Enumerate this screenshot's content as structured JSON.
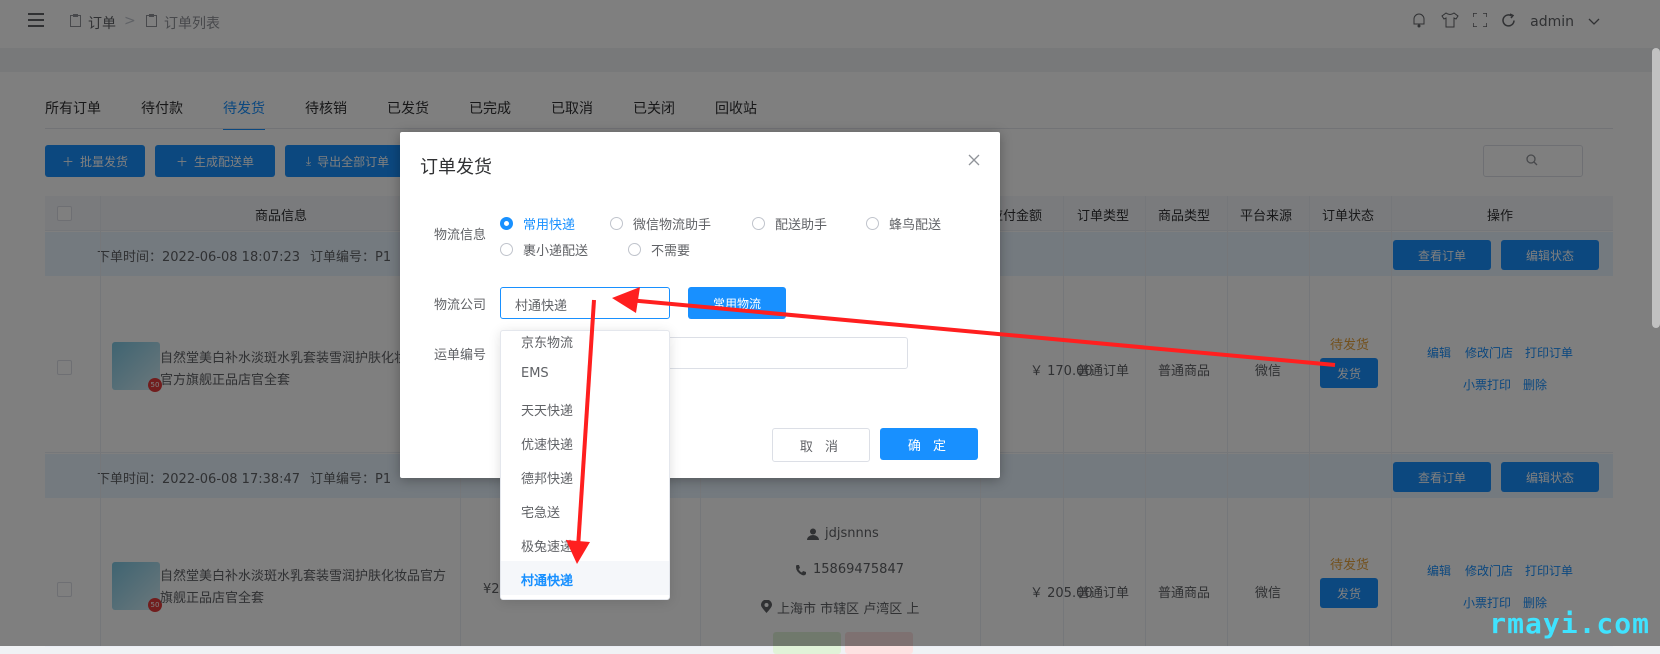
{
  "header": {
    "breadcrumb": [
      "订单",
      "订单列表"
    ],
    "separator": ">",
    "user": "admin"
  },
  "tabs": [
    "所有订单",
    "待付款",
    "待发货",
    "待核销",
    "已发货",
    "已完成",
    "已取消",
    "已关闭",
    "回收站"
  ],
  "active_tab": "待发货",
  "toolbar": {
    "batch_ship": "批量发货",
    "gen_delivery": "生成配送单",
    "export_all": "导出全部订单"
  },
  "table": {
    "columns": [
      "商品信息",
      "应付金额",
      "订单类型",
      "商品类型",
      "平台来源",
      "订单状态",
      "操作"
    ]
  },
  "orders": [
    {
      "time_label": "下单时间：2022-06-08 18:07:23",
      "no_label": "订单编号：P1",
      "product": "自然堂美白补水淡斑水乳套装雪润护肤化妆品官方旗舰正品店官全套",
      "amount": "￥ 170.00",
      "order_type": "普通订单",
      "goods_type": "普通商品",
      "source": "微信",
      "status": "待发货",
      "ship_btn": "发货",
      "view_btn": "查看订单",
      "edit_status_btn": "编辑状态",
      "links": [
        "编辑",
        "修改门店",
        "打印订单",
        "小票打印",
        "删除"
      ]
    },
    {
      "time_label": "下单时间：2022-06-08 17:38:47",
      "no_label": "订单编号：P1",
      "product": "自然堂美白补水淡斑水乳套装雪润护肤化妆品官方旗舰正品店官全套",
      "price_prefix": "¥2",
      "buyer": "jdjsnnns",
      "phone": "15869475847",
      "address": "上海市 市辖区 卢湾区 上",
      "amount": "￥ 205.00",
      "order_type": "普通订单",
      "goods_type": "普通商品",
      "source": "微信",
      "status": "待发货",
      "ship_btn": "发货",
      "view_btn": "查看订单",
      "edit_status_btn": "编辑状态",
      "links": [
        "编辑",
        "修改门店",
        "打印订单",
        "小票打印",
        "删除"
      ]
    }
  ],
  "dialog": {
    "title": "订单发货",
    "logistics_info_label": "物流信息",
    "logistics_options": [
      "常用快递",
      "微信物流助手",
      "配送助手",
      "蜂鸟配送",
      "裹小递配送",
      "不需要"
    ],
    "logistics_selected": "常用快递",
    "company_label": "物流公司",
    "company_value": "村通快递",
    "common_logistics_btn": "常用物流",
    "tracking_label": "运单编号",
    "cancel": "取 消",
    "confirm": "确 定"
  },
  "dropdown": {
    "options": [
      "京东物流",
      "EMS",
      "天天快递",
      "优速快递",
      "德邦快递",
      "宅急送",
      "极兔速递",
      "村通快递"
    ],
    "selected": "村通快递"
  },
  "watermark": "rmayi.com",
  "colors": {
    "primary": "#1890ff",
    "warning": "#e6a23c",
    "annotation_arrow": "#ff1f1f"
  }
}
